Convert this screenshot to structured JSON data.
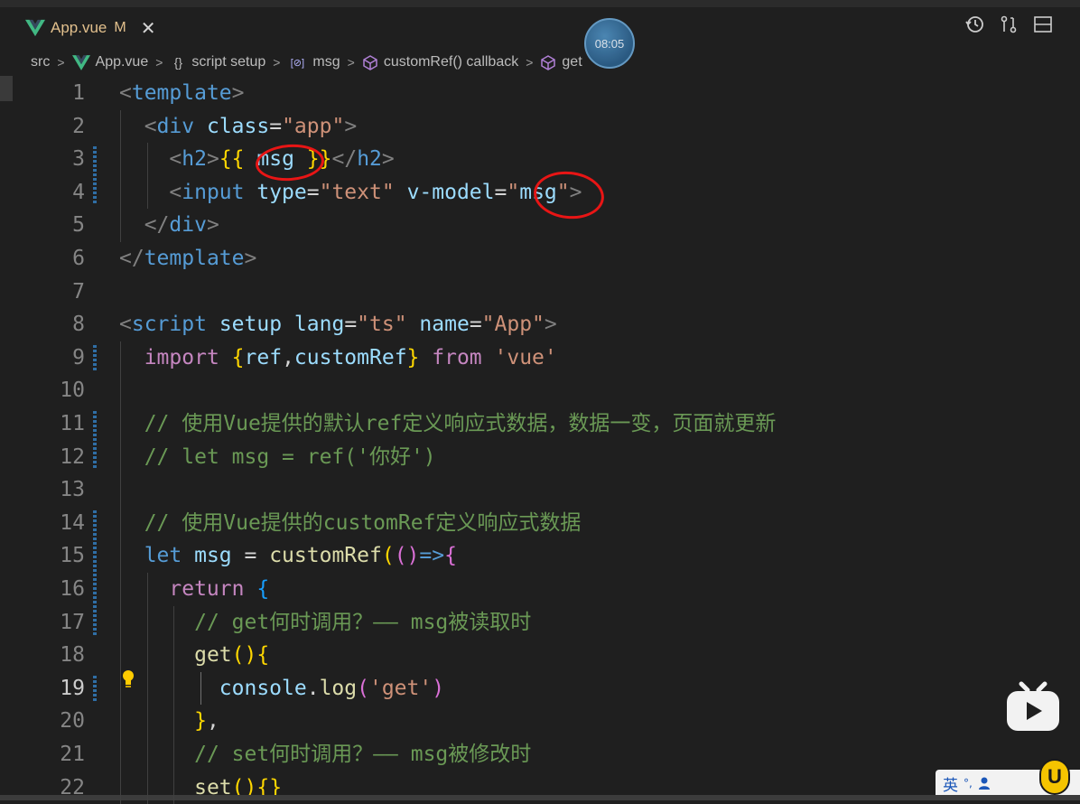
{
  "tab": {
    "filename": "App.vue",
    "modified_flag": "M",
    "close_glyph": "✕"
  },
  "timer_badge": "08:05",
  "tab_action_icons": [
    "history-icon",
    "compare-changes-icon",
    "split-editor-icon"
  ],
  "breadcrumb": {
    "items": [
      {
        "icon": "",
        "label": "src"
      },
      {
        "icon": "vue-icon",
        "label": "App.vue"
      },
      {
        "icon": "{}",
        "label": "script setup"
      },
      {
        "icon": "[⊘]",
        "label": "msg"
      },
      {
        "icon": "cube-icon",
        "label": "customRef() callback"
      },
      {
        "icon": "cube-icon",
        "label": "get"
      }
    ]
  },
  "editor": {
    "line_numbers": [
      "1",
      "2",
      "3",
      "4",
      "5",
      "6",
      "7",
      "8",
      "9",
      "10",
      "11",
      "12",
      "13",
      "14",
      "15",
      "16",
      "17",
      "18",
      "19",
      "20",
      "21",
      "22"
    ],
    "active_line": "19",
    "lines": [
      [
        {
          "t": "<",
          "c": "tag"
        },
        {
          "t": "template",
          "c": "tname"
        },
        {
          "t": ">",
          "c": "tag"
        }
      ],
      [
        {
          "t": "  "
        },
        {
          "t": "<",
          "c": "tag"
        },
        {
          "t": "div",
          "c": "tname"
        },
        {
          "t": " "
        },
        {
          "t": "class",
          "c": "attr"
        },
        {
          "t": "=",
          "c": "op"
        },
        {
          "t": "\"app\"",
          "c": "str"
        },
        {
          "t": ">",
          "c": "tag"
        }
      ],
      [
        {
          "t": "    "
        },
        {
          "t": "<",
          "c": "tag"
        },
        {
          "t": "h2",
          "c": "tname"
        },
        {
          "t": ">",
          "c": "tag"
        },
        {
          "t": "{{",
          "c": "br1"
        },
        {
          "t": " "
        },
        {
          "t": "msg",
          "c": "var"
        },
        {
          "t": " "
        },
        {
          "t": "}}",
          "c": "br1"
        },
        {
          "t": "</",
          "c": "tag"
        },
        {
          "t": "h2",
          "c": "tname"
        },
        {
          "t": ">",
          "c": "tag"
        }
      ],
      [
        {
          "t": "    "
        },
        {
          "t": "<",
          "c": "tag"
        },
        {
          "t": "input",
          "c": "tname"
        },
        {
          "t": " "
        },
        {
          "t": "type",
          "c": "attr"
        },
        {
          "t": "=",
          "c": "op"
        },
        {
          "t": "\"text\"",
          "c": "str"
        },
        {
          "t": " "
        },
        {
          "t": "v-model",
          "c": "attr"
        },
        {
          "t": "=",
          "c": "op"
        },
        {
          "t": "\"",
          "c": "str"
        },
        {
          "t": "msg",
          "c": "var"
        },
        {
          "t": "\"",
          "c": "str"
        },
        {
          "t": ">",
          "c": "tag"
        }
      ],
      [
        {
          "t": "  "
        },
        {
          "t": "</",
          "c": "tag"
        },
        {
          "t": "div",
          "c": "tname"
        },
        {
          "t": ">",
          "c": "tag"
        }
      ],
      [
        {
          "t": "</",
          "c": "tag"
        },
        {
          "t": "template",
          "c": "tname"
        },
        {
          "t": ">",
          "c": "tag"
        }
      ],
      [],
      [
        {
          "t": "<",
          "c": "tag"
        },
        {
          "t": "script",
          "c": "tname"
        },
        {
          "t": " "
        },
        {
          "t": "setup",
          "c": "attr"
        },
        {
          "t": " "
        },
        {
          "t": "lang",
          "c": "attr"
        },
        {
          "t": "=",
          "c": "op"
        },
        {
          "t": "\"ts\"",
          "c": "str"
        },
        {
          "t": " "
        },
        {
          "t": "name",
          "c": "attr"
        },
        {
          "t": "=",
          "c": "op"
        },
        {
          "t": "\"App\"",
          "c": "str"
        },
        {
          "t": ">",
          "c": "tag"
        }
      ],
      [
        {
          "t": "  "
        },
        {
          "t": "import",
          "c": "kw2"
        },
        {
          "t": " "
        },
        {
          "t": "{",
          "c": "br1"
        },
        {
          "t": "ref",
          "c": "var"
        },
        {
          "t": ","
        },
        {
          "t": "customRef",
          "c": "var"
        },
        {
          "t": "}",
          "c": "br1"
        },
        {
          "t": " "
        },
        {
          "t": "from",
          "c": "kw2"
        },
        {
          "t": " "
        },
        {
          "t": "'vue'",
          "c": "str"
        }
      ],
      [],
      [
        {
          "t": "  "
        },
        {
          "t": "// 使用Vue提供的默认ref定义响应式数据，数据一变，页面就更新",
          "c": "cmt"
        }
      ],
      [
        {
          "t": "  "
        },
        {
          "t": "// let msg = ref('你好')",
          "c": "cmt"
        }
      ],
      [],
      [
        {
          "t": "  "
        },
        {
          "t": "// 使用Vue提供的customRef定义响应式数据",
          "c": "cmt"
        }
      ],
      [
        {
          "t": "  "
        },
        {
          "t": "let",
          "c": "kw"
        },
        {
          "t": " "
        },
        {
          "t": "msg",
          "c": "var"
        },
        {
          "t": " = "
        },
        {
          "t": "customRef",
          "c": "fn"
        },
        {
          "t": "(",
          "c": "br1"
        },
        {
          "t": "()",
          "c": "br2"
        },
        {
          "t": "=>",
          "c": "kw"
        },
        {
          "t": "{",
          "c": "br2"
        }
      ],
      [
        {
          "t": "    "
        },
        {
          "t": "return",
          "c": "kw2"
        },
        {
          "t": " "
        },
        {
          "t": "{",
          "c": "br3"
        }
      ],
      [
        {
          "t": "      "
        },
        {
          "t": "// get何时调用？—— msg被读取时",
          "c": "cmt"
        }
      ],
      [
        {
          "t": "      "
        },
        {
          "t": "get",
          "c": "fn"
        },
        {
          "t": "()",
          "c": "br1"
        },
        {
          "t": "{",
          "c": "br1"
        }
      ],
      [
        {
          "t": "        "
        },
        {
          "t": "console",
          "c": "var"
        },
        {
          "t": "."
        },
        {
          "t": "log",
          "c": "fn"
        },
        {
          "t": "(",
          "c": "br2"
        },
        {
          "t": "'get'",
          "c": "str"
        },
        {
          "t": ")",
          "c": "br2"
        }
      ],
      [
        {
          "t": "      "
        },
        {
          "t": "}",
          "c": "br1"
        },
        {
          "t": ","
        }
      ],
      [
        {
          "t": "      "
        },
        {
          "t": "// set何时调用？—— msg被修改时",
          "c": "cmt"
        }
      ],
      [
        {
          "t": "      "
        },
        {
          "t": "set",
          "c": "fn"
        },
        {
          "t": "()",
          "c": "br1"
        },
        {
          "t": "{}",
          "c": "br1"
        }
      ]
    ]
  },
  "ime": {
    "label": "英",
    "punct": "°,",
    "logo_letter": "U"
  },
  "colors": {
    "background": "#1f1f1f",
    "accent_modified": "#e2c08d",
    "annotation_red": "#e81515"
  }
}
